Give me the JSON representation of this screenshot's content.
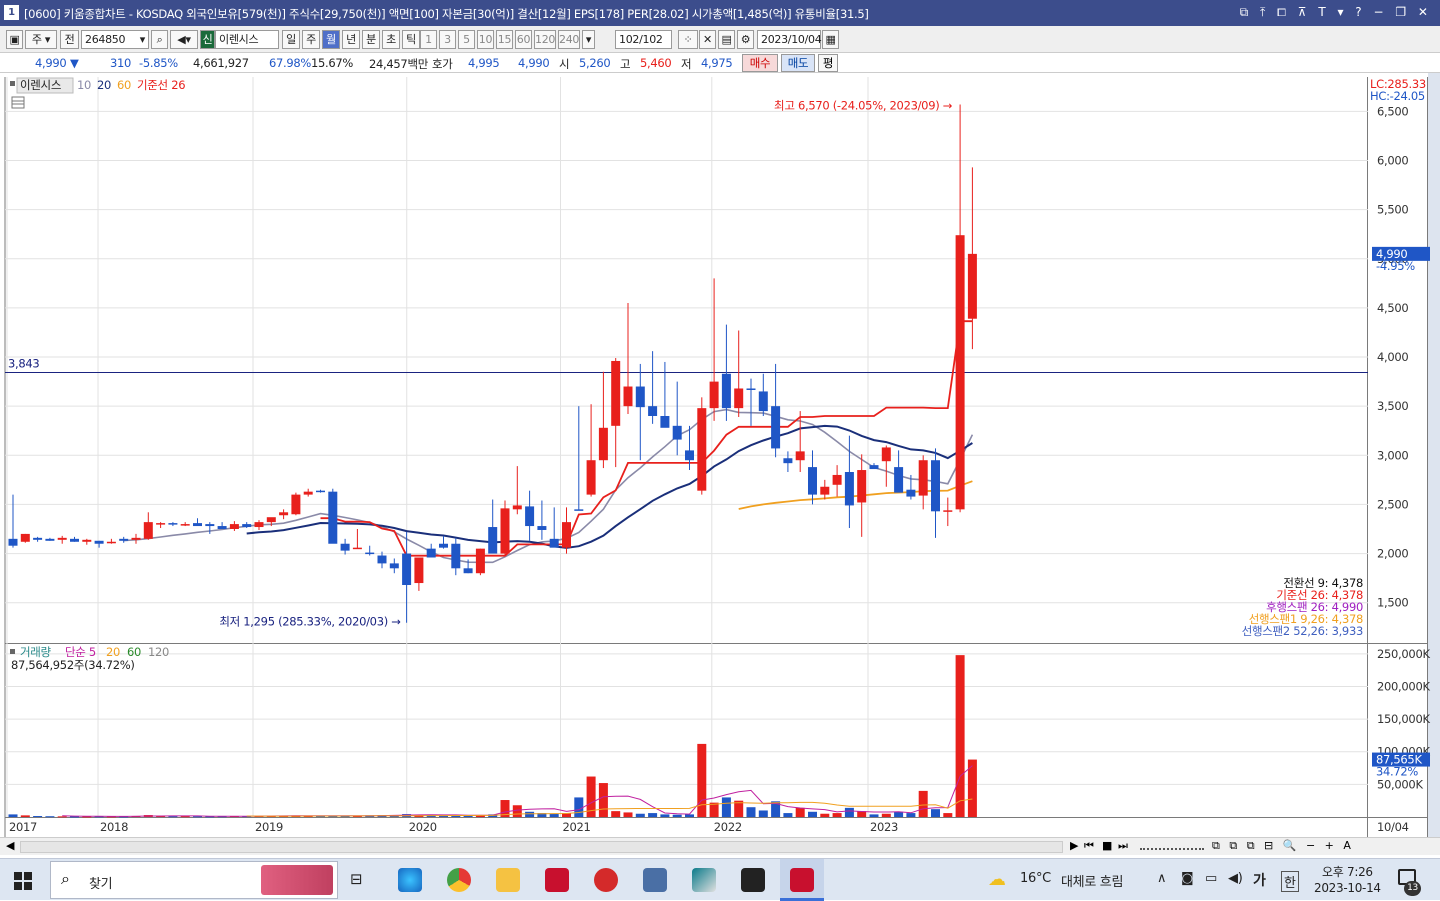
{
  "title": {
    "window_no": "1",
    "text": "[0600] 키움종합차트 - KOSDAQ 외국인보유[579(천)] 주식수[29,750(천)] 액면[100] 자본금[30(억)] 결산[12월] EPS[178] PER[28.02] 시가총액[1,485(억)] 유통비율[31.5]",
    "buttons": "⧉ ⤒ ⧠ ⊼ T ▾ ? − ❐ ✕"
  },
  "toolbar": {
    "period_unit": "주",
    "all_label": "전",
    "code": "264850",
    "indicator_new": "신",
    "indicator_name": "이렌시스",
    "period_tabs": [
      "일",
      "주",
      "월",
      "년",
      "분",
      "초",
      "틱"
    ],
    "selected_tab": "월",
    "minute_options": [
      "1",
      "3",
      "5",
      "10",
      "15",
      "60",
      "120",
      "240"
    ],
    "minute_selected": "240",
    "count": "102",
    "count_total": "/102",
    "date": "2023/10/04"
  },
  "quote": {
    "price": "4,990",
    "arrow": "▼",
    "change": "310",
    "change_pct": "-5.85%",
    "volume": "4,661,927",
    "vol_pct": "67.98%",
    "turnover_pct": "15.67%",
    "amount": "24,457백만",
    "hoga_label": "호가",
    "ask": "4,995",
    "bid": "4,990",
    "open_label": "시",
    "open": "5,260",
    "high_label": "고",
    "high": "5,460",
    "low_label": "저",
    "low": "4,975",
    "buy": "매수",
    "sell": "매도",
    "avg": "평"
  },
  "chart_data": {
    "type": "candlestick",
    "x_tick_labels": [
      "2017",
      "2018",
      "2019",
      "2020",
      "2021",
      "2022",
      "2023",
      "10/04"
    ],
    "price_axis": [
      "6,000",
      "5,500",
      "5,000",
      "4,500",
      "4,000",
      "3,500",
      "3,000",
      "2,500",
      "2,000",
      "1,500"
    ],
    "price_top_partial": "6,500",
    "ylim_price": [
      1100,
      6850
    ],
    "legend": {
      "name": "이렌시스",
      "ma": [
        "10",
        "20",
        "60"
      ],
      "kijun": "기준선 26"
    },
    "colors": {
      "up": "#e8201c",
      "down": "#1f56c6",
      "ma10": "#8a8aa8",
      "ma20": "#1a2f7a",
      "ma60": "#f0a020",
      "kijun": "#e8201c",
      "hline": "#1a2380"
    },
    "hline": {
      "value": 3843,
      "label": "3,843"
    },
    "lc_label": "LC:285.33",
    "hc_label": "HC:-24.05",
    "current_price_label": "4,990",
    "current_change_label": "-4.95%",
    "max_annotation": "최고 6,570 (-24.05%, 2023/09) →",
    "min_annotation": "최저 1,295 (285.33%, 2020/03) →",
    "ichimoku": [
      {
        "text": "전환선 9: 4,378",
        "color": "#111111"
      },
      {
        "text": "기준선 26: 4,378",
        "color": "#e8201c"
      },
      {
        "text": "후행스팬 26: 4,990",
        "color": "#a020c0"
      },
      {
        "text": "선행스팬1 9,26: 4,378",
        "color": "#f0a020"
      },
      {
        "text": "선행스팬2 52,26: 3,933",
        "color": "#4060c0"
      }
    ],
    "candles": [
      [
        2150,
        2600,
        2060,
        2080
      ],
      [
        2120,
        2200,
        2110,
        2200
      ],
      [
        2160,
        2170,
        2120,
        2140
      ],
      [
        2150,
        2160,
        2130,
        2130
      ],
      [
        2140,
        2180,
        2100,
        2160
      ],
      [
        2150,
        2170,
        2120,
        2120
      ],
      [
        2120,
        2150,
        2090,
        2140
      ],
      [
        2130,
        2130,
        2060,
        2100
      ],
      [
        2120,
        2150,
        2100,
        2120
      ],
      [
        2150,
        2170,
        2110,
        2130
      ],
      [
        2140,
        2200,
        2100,
        2160
      ],
      [
        2150,
        2420,
        2140,
        2320
      ],
      [
        2300,
        2320,
        2260,
        2310
      ],
      [
        2310,
        2320,
        2280,
        2300
      ],
      [
        2290,
        2320,
        2280,
        2300
      ],
      [
        2310,
        2360,
        2280,
        2280
      ],
      [
        2300,
        2320,
        2200,
        2280
      ],
      [
        2280,
        2320,
        2250,
        2250
      ],
      [
        2250,
        2330,
        2230,
        2300
      ],
      [
        2300,
        2320,
        2260,
        2270
      ],
      [
        2270,
        2340,
        2240,
        2320
      ],
      [
        2320,
        2350,
        2280,
        2370
      ],
      [
        2390,
        2450,
        2350,
        2420
      ],
      [
        2400,
        2620,
        2390,
        2600
      ],
      [
        2600,
        2660,
        2580,
        2630
      ],
      [
        2640,
        2650,
        2620,
        2630
      ],
      [
        2630,
        2660,
        2240,
        2100
      ],
      [
        2100,
        2150,
        1990,
        2030
      ],
      [
        2050,
        2250,
        2050,
        2060
      ],
      [
        2010,
        2080,
        1980,
        2000
      ],
      [
        1980,
        2020,
        1850,
        1900
      ],
      [
        1900,
        1950,
        1800,
        1850
      ],
      [
        2000,
        2220,
        1296,
        1680
      ],
      [
        1700,
        1960,
        1620,
        1960
      ],
      [
        2050,
        2100,
        1980,
        1960
      ],
      [
        2100,
        2180,
        2050,
        2060
      ],
      [
        2100,
        2160,
        1780,
        1850
      ],
      [
        1850,
        1940,
        1800,
        1800
      ],
      [
        1800,
        2050,
        1780,
        2050
      ],
      [
        2270,
        2550,
        2050,
        2000
      ],
      [
        2000,
        2540,
        1980,
        2460
      ],
      [
        2450,
        2890,
        2400,
        2490
      ],
      [
        2480,
        2640,
        2130,
        2280
      ],
      [
        2280,
        2540,
        2140,
        2240
      ],
      [
        2150,
        2470,
        2100,
        2060
      ],
      [
        2060,
        2470,
        2000,
        2320
      ],
      [
        2450,
        3500,
        2440,
        2440
      ],
      [
        2600,
        3520,
        2580,
        2950
      ],
      [
        2950,
        3850,
        2870,
        3280
      ],
      [
        3300,
        3990,
        2880,
        3960
      ],
      [
        3500,
        4550,
        3420,
        3700
      ],
      [
        3700,
        3930,
        2950,
        3490
      ],
      [
        3500,
        4060,
        3320,
        3400
      ],
      [
        3400,
        3950,
        3360,
        3280
      ],
      [
        3300,
        3750,
        3000,
        3160
      ],
      [
        3050,
        3300,
        2850,
        2950
      ],
      [
        2640,
        3590,
        2600,
        3480
      ],
      [
        3480,
        4800,
        3350,
        3750
      ],
      [
        3830,
        4330,
        3350,
        3480
      ],
      [
        3480,
        4270,
        3390,
        3680
      ],
      [
        3680,
        3780,
        3300,
        3670
      ],
      [
        3650,
        3830,
        3400,
        3450
      ],
      [
        3500,
        3930,
        2980,
        3070
      ],
      [
        2970,
        3040,
        2830,
        2920
      ],
      [
        2950,
        3450,
        2830,
        3040
      ],
      [
        2880,
        3050,
        2500,
        2600
      ],
      [
        2600,
        2750,
        2550,
        2680
      ],
      [
        2700,
        2900,
        2580,
        2800
      ],
      [
        2830,
        3200,
        2260,
        2490
      ],
      [
        2520,
        3010,
        2170,
        2850
      ],
      [
        2900,
        2920,
        2860,
        2860
      ],
      [
        2940,
        3100,
        2680,
        3080
      ],
      [
        2880,
        3050,
        2660,
        2620
      ],
      [
        2650,
        2800,
        2550,
        2580
      ],
      [
        2590,
        3000,
        2450,
        2950
      ],
      [
        2950,
        3070,
        2160,
        2430
      ],
      [
        2440,
        2570,
        2280,
        2440
      ],
      [
        2450,
        6570,
        2420,
        5240
      ],
      [
        4390,
        5930,
        4080,
        5050
      ]
    ],
    "volume_axis": [
      "250,000K",
      "200,000K",
      "150,000K",
      "100,000K",
      "50,000K"
    ],
    "ylim_volume": [
      0,
      262000
    ],
    "volume_legend": {
      "name": "거래량",
      "ma": [
        "단순 5",
        "20",
        "60",
        "120"
      ]
    },
    "volume_value_label": "87,564,952주(34.72%)",
    "current_volume_label": "87,565K",
    "current_volume_pct": "34.72%",
    "volume": [
      4000,
      2500,
      1500,
      1200,
      1000,
      800,
      900,
      1100,
      1000,
      900,
      1500,
      3000,
      1500,
      1200,
      1300,
      1100,
      1000,
      1200,
      1500,
      1400,
      1600,
      1800,
      2000,
      2400,
      2000,
      1600,
      1500,
      1800,
      2200,
      2600,
      3000,
      2400,
      4500,
      3600,
      3000,
      2500,
      2800,
      2200,
      3000,
      4000,
      26000,
      18000,
      8000,
      6000,
      5000,
      6000,
      30000,
      62000,
      52000,
      9000,
      7000,
      5000,
      6000,
      4000,
      3500,
      4000,
      112000,
      22000,
      30000,
      25000,
      15000,
      10000,
      24000,
      6000,
      14000,
      8000,
      5000,
      6000,
      14000,
      9000,
      4000,
      5000,
      8000,
      6000,
      40000,
      12000,
      6000,
      248000,
      88000
    ]
  },
  "hscroll": {
    "btns": [
      "◀",
      "▶",
      "⏮",
      "■",
      "⏭"
    ],
    "tools": "⧉ ⧉ ⧉ ⊟ 🔍 − + A"
  },
  "taskbar": {
    "search_label": "찾기",
    "weather_temp": "16°C",
    "weather_text": "대체로 흐림",
    "time": "오후 7:26",
    "date": "2023-10-14",
    "ime": "가",
    "lang": "한",
    "notif_count": "13"
  }
}
